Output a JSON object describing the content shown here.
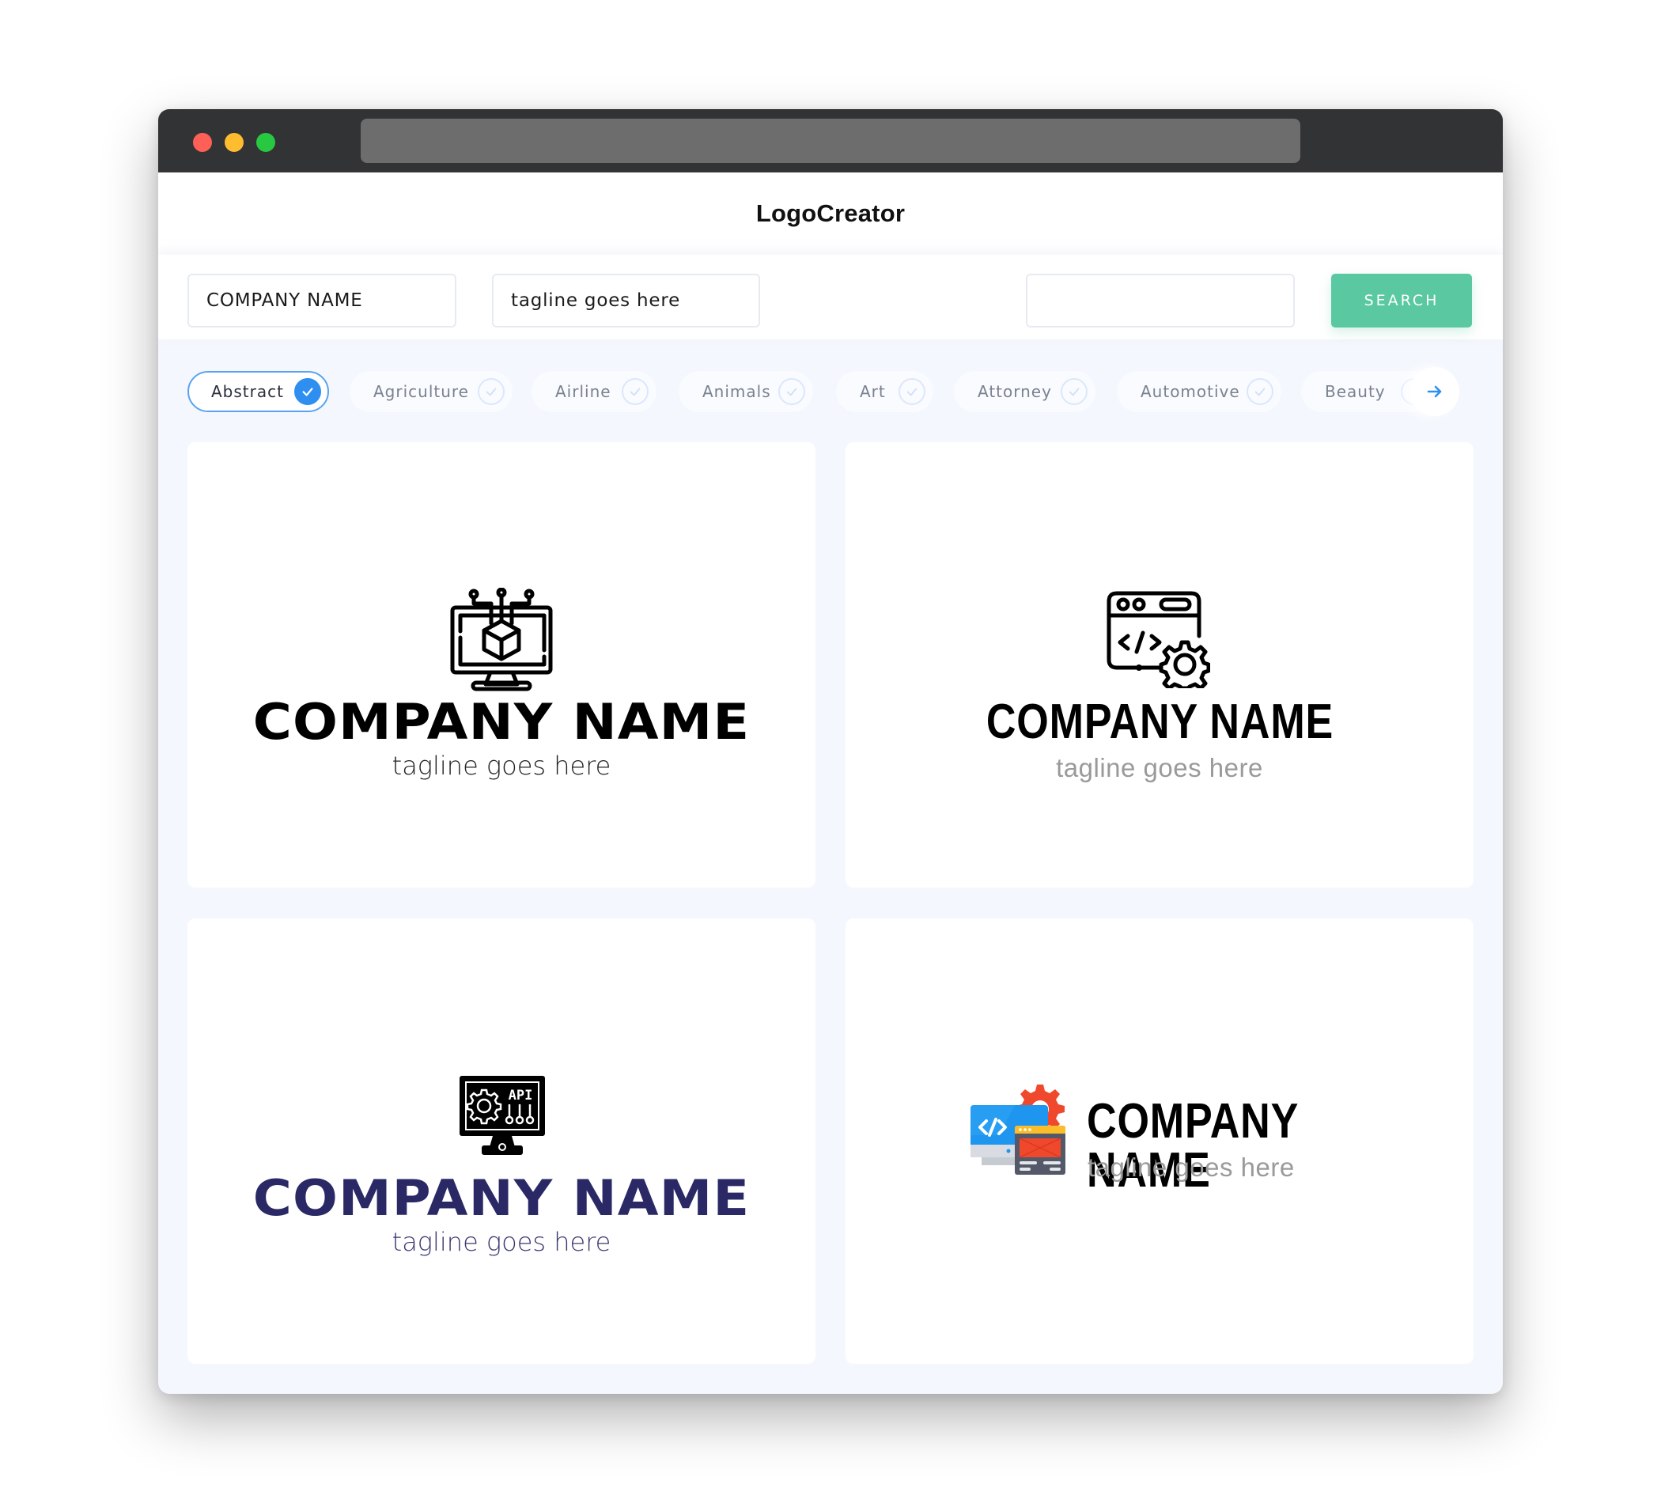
{
  "app": {
    "title": "LogoCreator"
  },
  "search": {
    "company_value": "COMPANY NAME",
    "tagline_value": "tagline goes here",
    "keyword_value": "",
    "button_label": "SEARCH"
  },
  "categories": [
    {
      "label": "Abstract",
      "selected": true
    },
    {
      "label": "Agriculture",
      "selected": false
    },
    {
      "label": "Airline",
      "selected": false
    },
    {
      "label": "Animals",
      "selected": false
    },
    {
      "label": "Art",
      "selected": false
    },
    {
      "label": "Attorney",
      "selected": false
    },
    {
      "label": "Automotive",
      "selected": false
    },
    {
      "label": "Beauty",
      "selected": false
    }
  ],
  "icons": {
    "check": "check-icon",
    "next": "arrow-right-icon"
  },
  "logos": [
    {
      "name": "COMPANY NAME",
      "tagline": "tagline goes here",
      "icon": "monitor-cube-network-icon",
      "name_color": "#000000",
      "tagline_color": "#222222"
    },
    {
      "name": "COMPANY NAME",
      "tagline": "tagline goes here",
      "icon": "browser-code-gear-icon",
      "name_color": "#000000",
      "tagline_color": "#9a9a9a"
    },
    {
      "name": "COMPANY NAME",
      "tagline": "tagline goes here",
      "icon": "monitor-api-gear-icon",
      "name_color": "#2a2966",
      "tagline_color": "#3a3970"
    },
    {
      "name": "COMPANY NAME",
      "tagline": "tagline goes here",
      "icon": "web-development-colored-icon",
      "name_color": "#000000",
      "tagline_color": "#9a9a9a"
    }
  ],
  "colors": {
    "accent_green": "#5ac8a0",
    "accent_blue": "#2f8ff0",
    "titlebar": "#323335"
  }
}
